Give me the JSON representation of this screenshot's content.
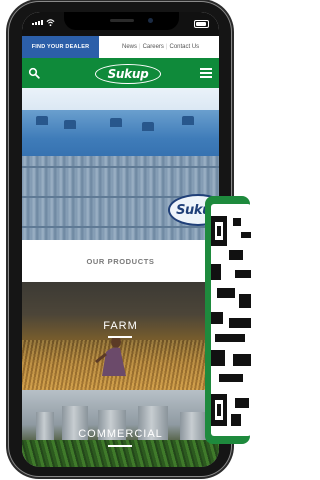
{
  "status_bar": {
    "signal_icon": "signal-bars-icon",
    "wifi_icon": "wifi-icon",
    "battery_icon": "battery-icon"
  },
  "top_bar": {
    "dealer_button": "FIND YOUR DEALER",
    "links": [
      "News",
      "Careers",
      "Contact Us"
    ]
  },
  "header": {
    "brand": "Sukup",
    "search_icon": "search-icon",
    "menu_icon": "hamburger-menu-icon",
    "color": "#0f8a3a"
  },
  "hero": {
    "sign_text": "Sukup"
  },
  "products": {
    "title": "OUR PRODUCTS"
  },
  "panels": {
    "farm": {
      "label": "FARM"
    },
    "commercial": {
      "label": "COMMERCIAL"
    }
  },
  "colors": {
    "brand_green": "#0f8a3a",
    "dealer_blue": "#2c5fa9"
  }
}
